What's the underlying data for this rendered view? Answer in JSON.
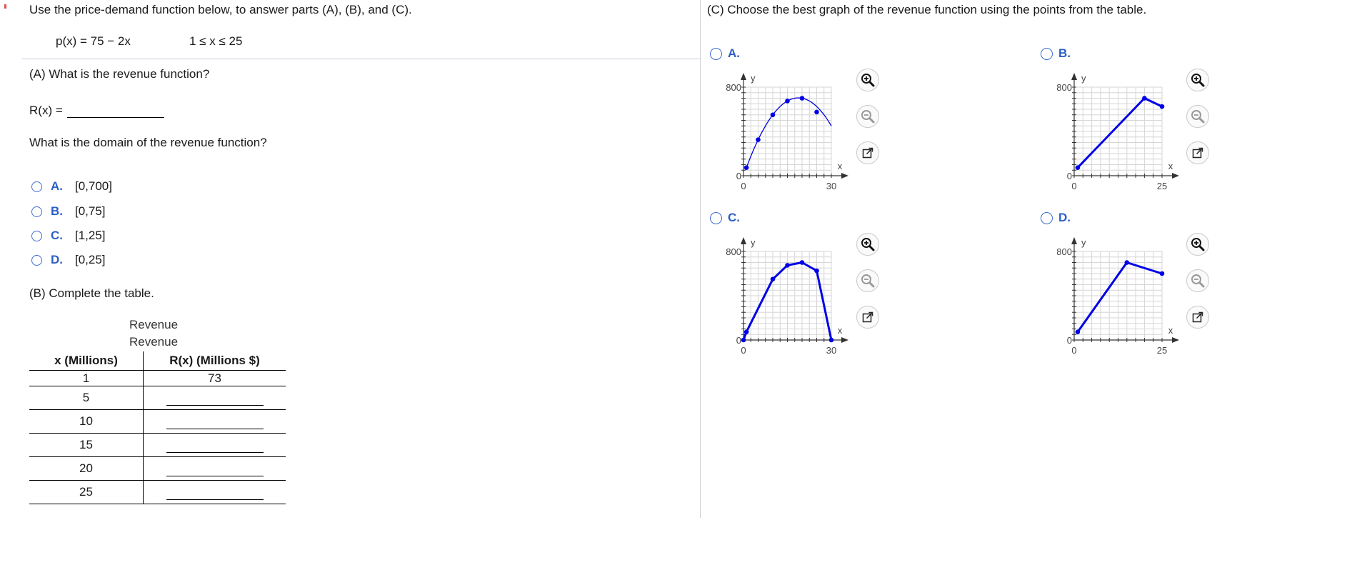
{
  "left": {
    "intro": "Use the price-demand function below, to answer parts (A), (B), and (C).",
    "price_function": "p(x) = 75 − 2x",
    "domain_constraint": "1 ≤ x ≤ 25",
    "part_a": {
      "question": "(A) What is the revenue function?",
      "answer_label": "R(x) =",
      "answer_value": "",
      "domain_question": "What is the domain of the revenue function?",
      "options": [
        {
          "letter": "A.",
          "text": "[0,700]"
        },
        {
          "letter": "B.",
          "text": "[0,75]"
        },
        {
          "letter": "C.",
          "text": "[1,25]"
        },
        {
          "letter": "D.",
          "text": "[0,25]"
        }
      ]
    },
    "part_b": {
      "question": "(B) Complete the table.",
      "caption_1": "Revenue",
      "caption_2": "Revenue",
      "headers": [
        "x (Millions)",
        "R(x) (Millions $)"
      ],
      "rows": [
        {
          "x": "1",
          "r": "73"
        },
        {
          "x": "5",
          "r": ""
        },
        {
          "x": "10",
          "r": ""
        },
        {
          "x": "15",
          "r": ""
        },
        {
          "x": "20",
          "r": ""
        },
        {
          "x": "25",
          "r": ""
        }
      ]
    }
  },
  "right": {
    "question": "(C) Choose the best graph of the revenue function using the points from the table.",
    "options": [
      {
        "letter": "A.",
        "y_tick": "800",
        "y_zero": "0",
        "x_zero": "0",
        "x_tick": "30",
        "x_label": "x",
        "y_label": "y"
      },
      {
        "letter": "B.",
        "y_tick": "800",
        "y_zero": "0",
        "x_zero": "0",
        "x_tick": "25",
        "x_label": "x",
        "y_label": "y"
      },
      {
        "letter": "C.",
        "y_tick": "800",
        "y_zero": "0",
        "x_zero": "0",
        "x_tick": "30",
        "x_label": "x",
        "y_label": "y"
      },
      {
        "letter": "D.",
        "y_tick": "800",
        "y_zero": "0",
        "x_zero": "0",
        "x_tick": "25",
        "x_label": "x",
        "y_label": "y"
      }
    ],
    "tools": [
      "zoom-in-icon",
      "zoom-out-icon",
      "pop-out-icon"
    ]
  },
  "chart_data": [
    {
      "type": "line",
      "smooth": true,
      "x": [
        1,
        5,
        10,
        15,
        20,
        25
      ],
      "y": [
        73,
        325,
        550,
        675,
        700,
        575
      ],
      "xlim": [
        0,
        30
      ],
      "ylim": [
        0,
        800
      ],
      "x_major_ticks": [
        0,
        30
      ],
      "y_major_ticks": [
        0,
        800
      ],
      "grid": true,
      "color": "#0000e6"
    },
    {
      "type": "line",
      "smooth": false,
      "x": [
        1,
        20,
        25
      ],
      "y": [
        73,
        700,
        625
      ],
      "xlim": [
        0,
        25
      ],
      "ylim": [
        0,
        800
      ],
      "x_major_ticks": [
        0,
        25
      ],
      "y_major_ticks": [
        0,
        800
      ],
      "grid": true,
      "color": "#0000e6"
    },
    {
      "type": "line",
      "smooth": false,
      "x": [
        0,
        1,
        10,
        15,
        20,
        25,
        30
      ],
      "y": [
        0,
        73,
        550,
        675,
        700,
        625,
        0
      ],
      "xlim": [
        0,
        30
      ],
      "ylim": [
        0,
        800
      ],
      "x_major_ticks": [
        0,
        30
      ],
      "y_major_ticks": [
        0,
        800
      ],
      "grid": true,
      "color": "#0000e6"
    },
    {
      "type": "line",
      "smooth": false,
      "x": [
        1,
        15,
        25
      ],
      "y": [
        73,
        700,
        600
      ],
      "xlim": [
        0,
        25
      ],
      "ylim": [
        0,
        800
      ],
      "x_major_ticks": [
        0,
        25
      ],
      "y_major_ticks": [
        0,
        800
      ],
      "grid": true,
      "color": "#0000e6"
    }
  ]
}
